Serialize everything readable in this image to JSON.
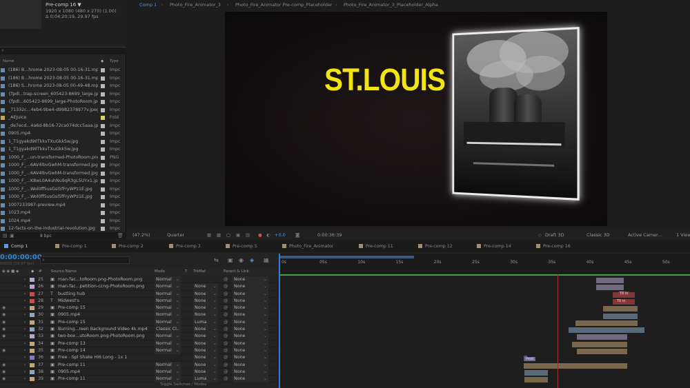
{
  "project": {
    "comp_name": "Pre-comp 16 ▼",
    "comp_info1": "1920 x 1080  (480 x 270) (1.00)",
    "comp_info2": "Δ 0;04;20;19, 29.97 fps",
    "col_name": "Name",
    "col_type": "Type",
    "footer_bpc": "8 bpc",
    "items": [
      {
        "name": "(186) B...hrome 2023-08-05 00-16-31.mp4",
        "type": "Impc"
      },
      {
        "name": "(186) B...hrome 2023-08-05 00-16-31.mp4",
        "type": "Impc"
      },
      {
        "name": "(186) S...hrome 2023-08-05 00-49-48.mp4",
        "type": "Impc"
      },
      {
        "name": "{fpdl...trap-screen_605423-8699_large.jpg",
        "type": "Impc"
      },
      {
        "name": "{fpdl...605423-8699_large-PhotoRoom.jpg",
        "type": "Impc"
      },
      {
        "name": "_71332c...4eb4-9be4-d9982378877v.jpeg",
        "type": "Impc"
      },
      {
        "name": "_AEJuice",
        "type": "Fold"
      },
      {
        "name": "_de7ecd...4a6d-8b16-72ca074dcc5aaa.jpeg",
        "type": "Impc"
      },
      {
        "name": "0905.mp4",
        "type": "Impc"
      },
      {
        "name": "1_T1gyakd9IlTkkvTXuGkk5w.jpg",
        "type": "Impc"
      },
      {
        "name": "1_T1gyakd9IlTkkvTXuGkk5w.jpg",
        "type": "Impc"
      },
      {
        "name": "1000_F_...un-transformed-PhotoRoom.png",
        "type": "PNG"
      },
      {
        "name": "1000_F_...6AV4lbvGwhM-transformed.jpg",
        "type": "Impc"
      },
      {
        "name": "1000_F_...6AV4lbvGwhM-transformed.jpg",
        "type": "Impc"
      },
      {
        "name": "1000_F_...K8wL0A4uhNu9qR3gL5UYx1.jpg",
        "type": "Impc"
      },
      {
        "name": "1000_F_...Wol0ff5usGsl5fFryWPz1E.jpg",
        "type": "Impc"
      },
      {
        "name": "1000_F_...Wol0ff5usGsl5fFryWPz1E.jpg",
        "type": "Impc"
      },
      {
        "name": "1007233987-preview.mp4",
        "type": "Impc"
      },
      {
        "name": "1023.mp4",
        "type": "Impc"
      },
      {
        "name": "1024.mp4",
        "type": "Impc"
      },
      {
        "name": "12-facts-on-the-industrial-revolution.jpg",
        "type": "Impc"
      }
    ]
  },
  "viewer": {
    "tabs": [
      "Comp 1",
      "Photo_Fire_Animator_3",
      "Photo_Fire_Animator Pre-comp_Placeholder",
      "Photo_Fire_Animator_3_Placeholder_Alpha"
    ],
    "title_text": "ST.LOUIS",
    "zoom": "(47.2%)",
    "resolution": "Quarter",
    "exposure": "+0.0",
    "timecode": "0:00:36:39",
    "draft3d": "Draft 3D",
    "renderer": "Classic 3D",
    "camera": "Active Camer...",
    "views": "1 View"
  },
  "timeline": {
    "tabs": [
      "Comp 1",
      "Pre-comp 1",
      "Pre-comp 2",
      "Pre-comp 3",
      "Pre-comp 5",
      "Photo_Fire_Animator",
      "Pre-comp 11",
      "Pre-comp 12",
      "Pre-comp 14",
      "Pre-comp 16"
    ],
    "timecode": "0:00:00:00",
    "fps": "00000 (29.97 fps)",
    "cols": {
      "num": "#",
      "source": "Source Name",
      "mode": "Mode",
      "t": "T",
      "trkmat": "TrkMat",
      "parent": "Parent & Link"
    },
    "ticks": [
      "0s",
      "05s",
      "10s",
      "15s",
      "20s",
      "25s",
      "30s",
      "35s",
      "40s",
      "45s",
      "50s"
    ],
    "layers": [
      {
        "num": "25",
        "icon": "▣",
        "name": "man-fac...toRoom.png-PhotoRoom.png",
        "mode": "Normal",
        "trk": "",
        "parent": "None",
        "color": "#b7a7d0"
      },
      {
        "num": "26",
        "icon": "▣",
        "name": "man-fac...petition-ccng-PhotoRoom.png",
        "mode": "Normal",
        "trk": "None",
        "parent": "None",
        "color": "#b7a7d0"
      },
      {
        "num": "27",
        "icon": "T",
        "name": "bustling hub",
        "mode": "Normal",
        "trk": "None",
        "parent": "None",
        "color": "#d04a4a"
      },
      {
        "num": "28",
        "icon": "T",
        "name": "Midwest's",
        "mode": "Normal",
        "trk": "None",
        "parent": "None",
        "color": "#d04a4a"
      },
      {
        "num": "29",
        "icon": "▣",
        "name": "Pre-comp 15",
        "mode": "Normal",
        "trk": "None",
        "parent": "None",
        "color": "#c7a576"
      },
      {
        "num": "30",
        "icon": "▣",
        "name": "0905.mp4",
        "mode": "Normal",
        "trk": "None",
        "parent": "None",
        "color": "#8ca7c4"
      },
      {
        "num": "31",
        "icon": "▣",
        "name": "Pre-comp 15",
        "mode": "Normal",
        "trk": "Luma",
        "parent": "None",
        "color": "#c7a576"
      },
      {
        "num": "32",
        "icon": "▣",
        "name": "Burning...reen Background Video 4k.mp4",
        "mode": "Classic Cl",
        "trk": "None",
        "parent": "None",
        "color": "#8ca7c4"
      },
      {
        "num": "33",
        "icon": "▣",
        "name": "two-box...utoRoom.png-PhotoRoom.png",
        "mode": "Normal",
        "trk": "None",
        "parent": "None",
        "color": "#b7a7d0"
      },
      {
        "num": "34",
        "icon": "▣",
        "name": "Pre-comp 13",
        "mode": "Normal",
        "trk": "None",
        "parent": "None",
        "color": "#c7a576"
      },
      {
        "num": "35",
        "icon": "▣",
        "name": "Pre-comp 14",
        "mode": "Normal",
        "trk": "None",
        "parent": "None",
        "color": "#c7a576"
      },
      {
        "num": "36",
        "icon": "▣",
        "name": "Free - Spl Shake Hi6 Long - 1x 1",
        "mode": "",
        "trk": "None",
        "parent": "None",
        "color": "#7b7bd0"
      },
      {
        "num": "37",
        "icon": "▣",
        "name": "Pre-comp 11",
        "mode": "Normal",
        "trk": "None",
        "parent": "None",
        "color": "#c7a576"
      },
      {
        "num": "38",
        "icon": "▣",
        "name": "0905.mp4",
        "mode": "Normal",
        "trk": "None",
        "parent": "None",
        "color": "#8ca7c4"
      },
      {
        "num": "39",
        "icon": "▣",
        "name": "Pre-comp 11",
        "mode": "Normal",
        "trk": "Luma",
        "parent": "None",
        "color": "#c7a576"
      }
    ],
    "marker1": "T8 in",
    "marker2": "T8 in",
    "marker3": "Peak",
    "footer": "Toggle Switches / Modes"
  }
}
